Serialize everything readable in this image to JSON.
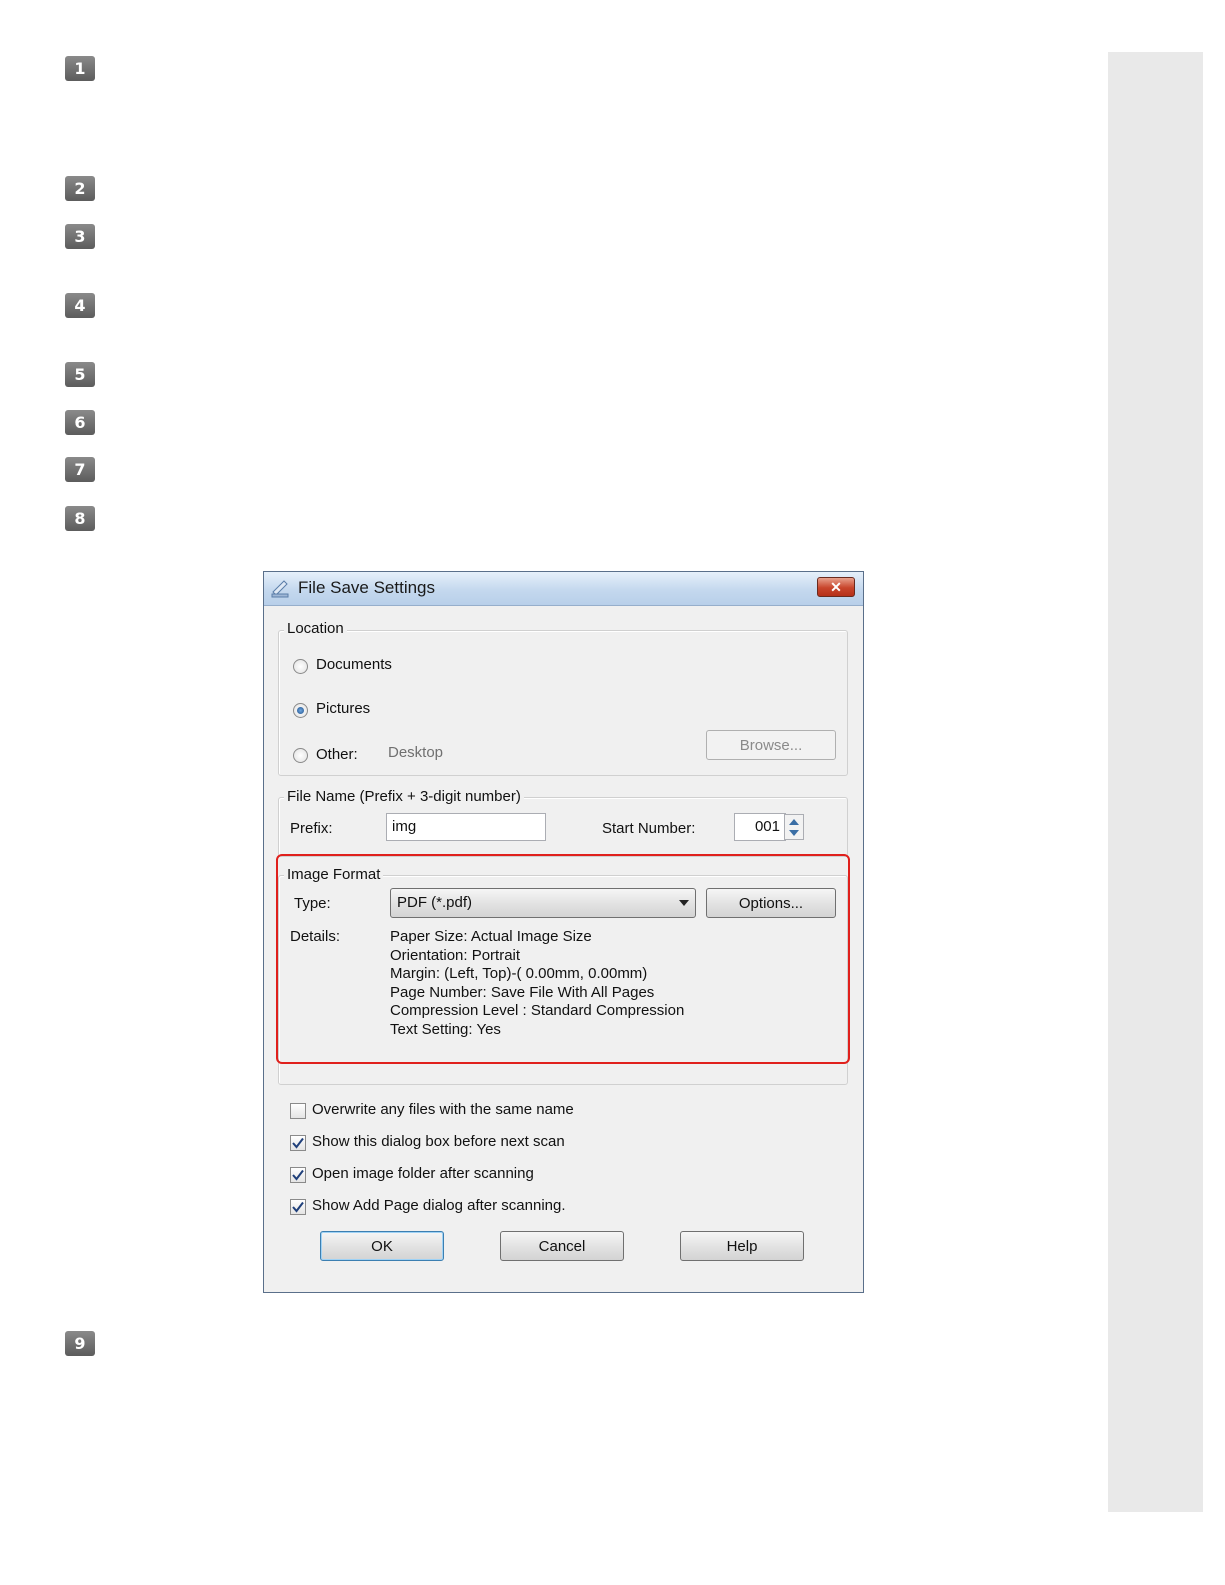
{
  "steps": [
    "1",
    "2",
    "3",
    "4",
    "5",
    "6",
    "7",
    "8",
    "9"
  ],
  "dialog": {
    "title": "File Save Settings",
    "close_symbol": "✕",
    "location": {
      "label": "Location",
      "documents": "Documents",
      "pictures": "Pictures",
      "other": "Other:",
      "other_value": "Desktop",
      "browse": "Browse...",
      "selected": "Pictures"
    },
    "file_name": {
      "label": "File Name (Prefix + 3-digit number)",
      "prefix_label": "Prefix:",
      "prefix_value": "img",
      "start_number_label": "Start Number:",
      "start_number_value": "001"
    },
    "image_format": {
      "label": "Image Format",
      "type_label": "Type:",
      "type_value": "PDF (*.pdf)",
      "options": "Options...",
      "details_label": "Details:",
      "details": [
        "Paper Size: Actual Image Size",
        "Orientation: Portrait",
        "Margin: (Left, Top)-( 0.00mm, 0.00mm)",
        "Page Number: Save File With All Pages",
        "Compression Level : Standard Compression",
        "Text Setting: Yes"
      ]
    },
    "checkboxes": [
      {
        "label": "Overwrite any files with the same name",
        "checked": false
      },
      {
        "label": "Show this dialog box before next scan",
        "checked": true
      },
      {
        "label": "Open image folder after scanning",
        "checked": true
      },
      {
        "label": "Show Add Page dialog after scanning.",
        "checked": true
      }
    ],
    "buttons": {
      "ok": "OK",
      "cancel": "Cancel",
      "help": "Help"
    },
    "highlight_color": "#e0201c"
  }
}
